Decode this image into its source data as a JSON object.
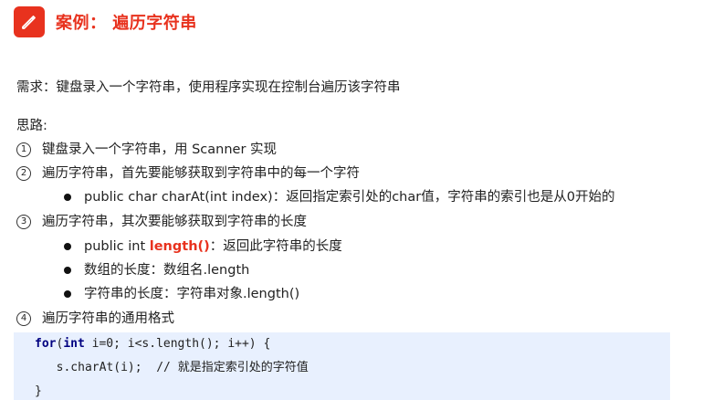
{
  "header": {
    "title": "案例： 遍历字符串",
    "icon": "pencil-icon",
    "accent_color": "#e8321e"
  },
  "requirement": "需求：键盘录入一个字符串，使用程序实现在控制台遍历该字符串",
  "idea_label": "思路:",
  "steps": [
    {
      "num": "1",
      "text": "键盘录入一个字符串，用 Scanner 实现"
    },
    {
      "num": "2",
      "text": "遍历字符串，首先要能够获取到字符串中的每一个字符"
    },
    {
      "num": "3",
      "text": "遍历字符串，其次要能够获取到字符串的长度"
    },
    {
      "num": "4",
      "text": "遍历字符串的通用格式"
    }
  ],
  "bullets": {
    "charAt": "public char charAt(int index)：返回指定索引处的char值，字符串的索引也是从0开始的",
    "length_prefix": "public int ",
    "length_method": "length()",
    "length_suffix": "：返回此字符串的长度",
    "array_length": "数组的长度：数组名.length",
    "string_length": "字符串的长度：字符串对象.length()"
  },
  "code": {
    "for_kw": "for",
    "paren_open": "(",
    "int_kw": "int",
    "line1_rest": " i=0; i<s.length(); i++) {",
    "line2_code": "  s.charAt(i);  ",
    "line2_comment": "// 就是指定索引处的字符值",
    "line3": "}",
    "background": "#e8f0fe"
  }
}
